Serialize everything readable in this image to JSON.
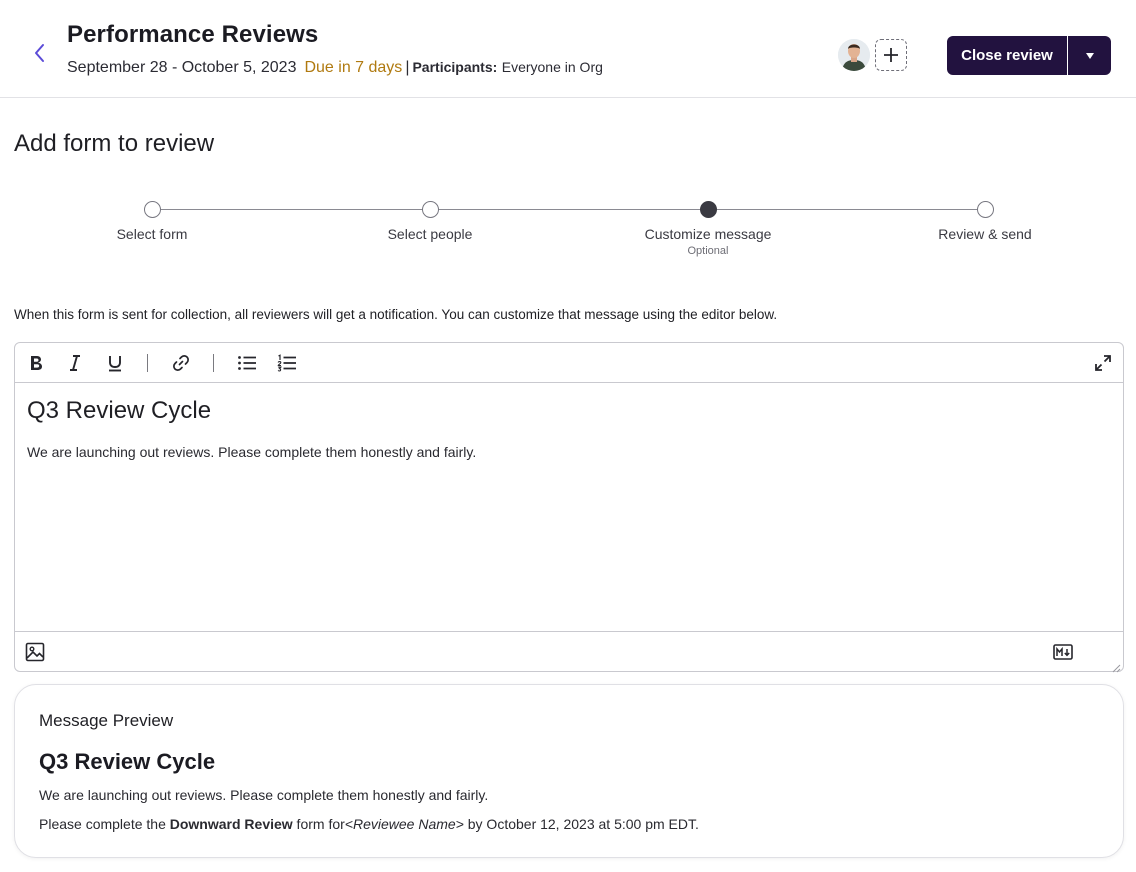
{
  "header": {
    "title": "Performance Reviews",
    "date_range": "September 28 - October 5, 2023",
    "due": "Due in 7 days",
    "separator": "|",
    "participants_label": "Participants:",
    "participants_value": "Everyone in Org",
    "close_button_label": "Close review"
  },
  "page": {
    "title": "Add form to review"
  },
  "stepper": {
    "steps": [
      {
        "label": "Select form",
        "sub": "",
        "state": "pending"
      },
      {
        "label": "Select people",
        "sub": "",
        "state": "pending"
      },
      {
        "label": "Customize message",
        "sub": "Optional",
        "state": "active"
      },
      {
        "label": "Review & send",
        "sub": "",
        "state": "pending"
      }
    ]
  },
  "instructions": "When this form is sent for collection, all reviewers will get a notification. You can customize that message using the editor below.",
  "editor": {
    "heading": "Q3 Review Cycle",
    "body": "We are launching out reviews. Please complete them honestly and fairly.",
    "toolbar": [
      "bold-icon",
      "italic-icon",
      "underline-icon",
      "link-icon",
      "bullet-list-icon",
      "numbered-list-icon",
      "expand-icon"
    ],
    "footer": [
      "image-icon",
      "markdown-icon"
    ]
  },
  "preview": {
    "title": "Message Preview",
    "heading": "Q3 Review Cycle",
    "body": "We are launching out reviews. Please complete them honestly and fairly.",
    "cta_prefix": "Please complete the ",
    "cta_form": "Downward Review",
    "cta_middle": " form for",
    "cta_placeholder": "<Reviewee Name>",
    "cta_suffix": " by October 12, 2023 at 5:00 pm EDT."
  },
  "colors": {
    "primary_button": "#22123f",
    "due_text": "#b07a10",
    "back_arrow": "#5b4bd8"
  }
}
